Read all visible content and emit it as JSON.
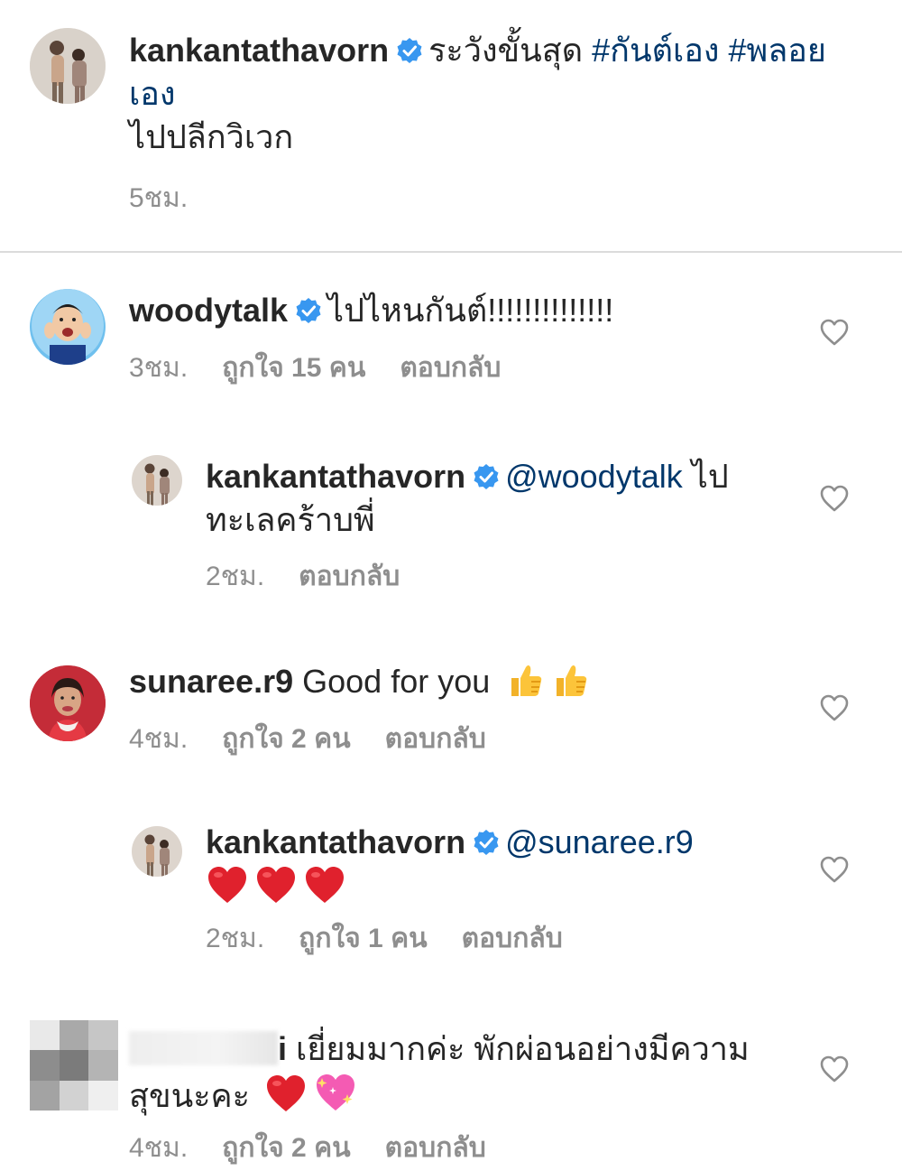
{
  "post": {
    "username": "kankantathavorn",
    "caption_text": "ระวังขั้นสุด",
    "hashtag_1": "#กันต์เอง",
    "hashtag_2": "#พลอย",
    "hashtag_2_cont": "เอง",
    "line_2": "ไปปลีกวิเวก",
    "time": "5ชม."
  },
  "comments": [
    {
      "username": "woodytalk",
      "verified": true,
      "text": "ไปไหนกันต์!!!!!!!!!!!!!!",
      "time": "3ชม.",
      "likes": "ถูกใจ 15 คน",
      "reply": "ตอบกลับ"
    },
    {
      "username": "kankantathavorn",
      "verified": true,
      "mention": "@woodytalk",
      "text_line1": "ไป",
      "text_line2": "ทะเลคร้าบพี่",
      "time": "2ชม.",
      "reply": "ตอบกลับ"
    },
    {
      "username": "sunaree.r9",
      "verified": false,
      "text": "Good for you",
      "emojis": [
        "thumbs-up",
        "thumbs-up"
      ],
      "time": "4ชม.",
      "likes": "ถูกใจ 2 คน",
      "reply": "ตอบกลับ"
    },
    {
      "username": "kankantathavorn",
      "verified": true,
      "mention": "@sunaree.r9",
      "emojis": [
        "red-heart",
        "red-heart",
        "red-heart"
      ],
      "time": "2ชม.",
      "likes": "ถูกใจ 1 คน",
      "reply": "ตอบกลับ"
    },
    {
      "username_visible_fragment": "i",
      "text_line1": "เยี่ยมมากค่ะ พักผ่อนอย่างมีความ",
      "text_line2": "สุขนะคะ",
      "emojis": [
        "red-heart",
        "sparkling-heart"
      ],
      "time": "4ชม.",
      "likes": "ถูกใจ 2 คน",
      "reply": "ตอบกลับ"
    }
  ],
  "colors": {
    "link": "#00376b",
    "verified": "#3897f0",
    "meta": "#8e8e8e",
    "divider": "#dbdbdb"
  }
}
